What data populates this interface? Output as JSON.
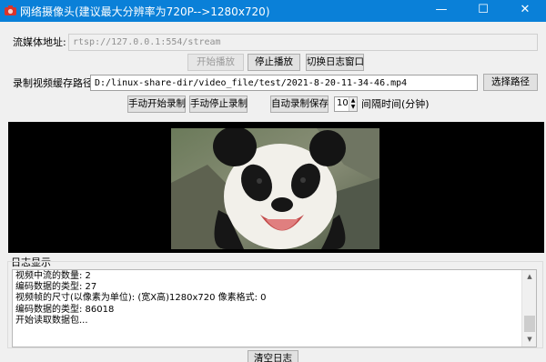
{
  "window": {
    "title": "网络摄像头(建议最大分辨率为720P-->1280x720)",
    "minimize_glyph": "—",
    "maximize_glyph": "☐",
    "close_glyph": "✕",
    "titlebar_color": "#0a80d8",
    "icon": "camera-icon"
  },
  "stream": {
    "label": "流媒体地址:",
    "url": "rtsp://127.0.0.1:554/stream"
  },
  "controls": {
    "start_play": "开始播放",
    "stop_play": "停止播放",
    "toggle_log": "切换日志窗口"
  },
  "record": {
    "path_label": "录制视频缓存路径:",
    "path": "D:/linux-share-dir/video_file/test/2021-8-20-11-34-46.mp4",
    "choose_path": "选择路径",
    "manual_start": "手动开始录制",
    "manual_stop": "手动停止录制",
    "auto_save": "自动录制保存",
    "interval_value": "10",
    "interval_label": "间隔时间(分钟)"
  },
  "log": {
    "section_label": "日志显示",
    "lines": [
      "视频中流的数量: 2",
      "编码数据的类型: 27",
      "视频帧的尺寸(以像素为单位): (宽X高)1280x720 像素格式: 0",
      "编码数据的类型: 86018",
      "开始读取数据包..."
    ],
    "clear_button": "清空日志"
  },
  "video": {
    "subject": "panda-video-frame"
  }
}
